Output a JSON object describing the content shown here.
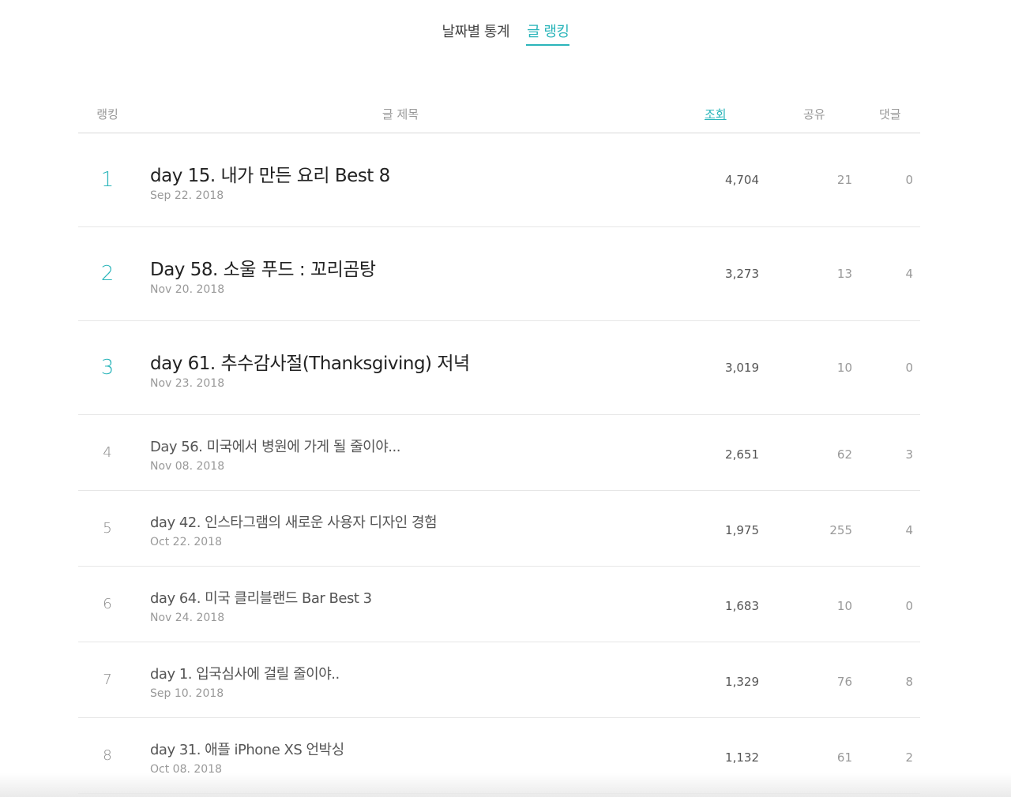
{
  "tabs": [
    {
      "label": "날짜별 통계",
      "active": false
    },
    {
      "label": "글 랭킹",
      "active": true
    }
  ],
  "columns": {
    "rank": "랭킹",
    "title": "글 제목",
    "views": "조회",
    "shares": "공유",
    "comments": "댓글"
  },
  "accent_color": "#2bb5ba",
  "rows": [
    {
      "rank": "1",
      "title": "day 15. 내가 만든 요리 Best 8",
      "date": "Sep 22. 2018",
      "views": "4,704",
      "shares": "21",
      "comments": "0"
    },
    {
      "rank": "2",
      "title": "Day 58. 소울 푸드 : 꼬리곰탕",
      "date": "Nov 20. 2018",
      "views": "3,273",
      "shares": "13",
      "comments": "4"
    },
    {
      "rank": "3",
      "title": "day 61. 추수감사절(Thanksgiving) 저녁",
      "date": "Nov 23. 2018",
      "views": "3,019",
      "shares": "10",
      "comments": "0"
    },
    {
      "rank": "4",
      "title": "Day 56. 미국에서 병원에 가게 될 줄이야...",
      "date": "Nov 08. 2018",
      "views": "2,651",
      "shares": "62",
      "comments": "3"
    },
    {
      "rank": "5",
      "title": "day 42. 인스타그램의 새로운 사용자 디자인 경험",
      "date": "Oct 22. 2018",
      "views": "1,975",
      "shares": "255",
      "comments": "4"
    },
    {
      "rank": "6",
      "title": "day 64. 미국 클리블랜드 Bar Best 3",
      "date": "Nov 24. 2018",
      "views": "1,683",
      "shares": "10",
      "comments": "0"
    },
    {
      "rank": "7",
      "title": "day 1. 입국심사에 걸릴 줄이야..",
      "date": "Sep 10. 2018",
      "views": "1,329",
      "shares": "76",
      "comments": "8"
    },
    {
      "rank": "8",
      "title": "day 31. 애플 iPhone XS 언박싱",
      "date": "Oct 08. 2018",
      "views": "1,132",
      "shares": "61",
      "comments": "2"
    }
  ]
}
